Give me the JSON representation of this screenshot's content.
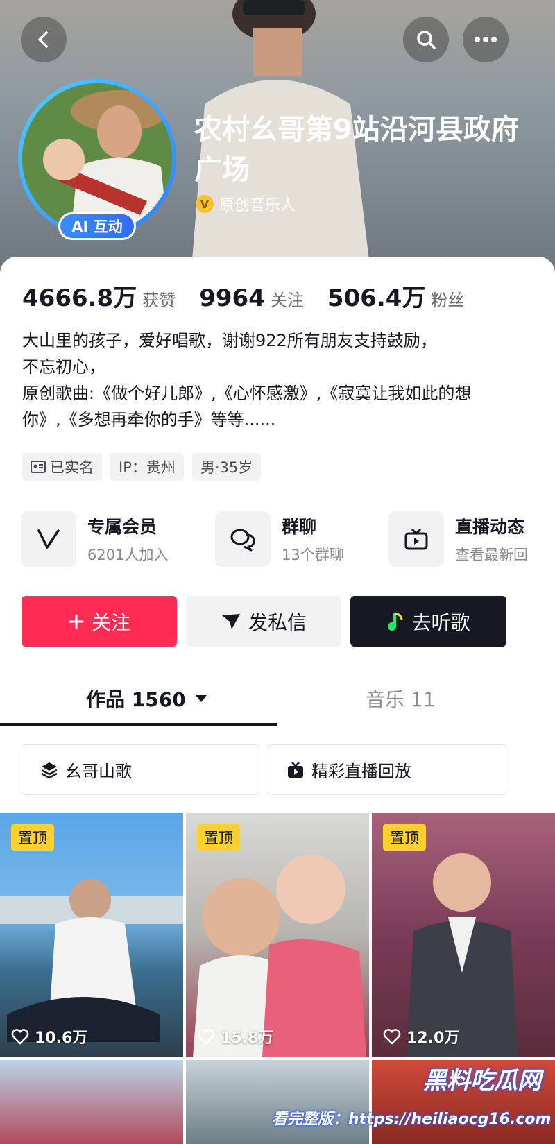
{
  "header": {
    "nickname": "农村幺哥第9站沿河县政府广场",
    "verify_label": "原创音乐人",
    "ai_badge": "AI 互动",
    "verify_mark": "V"
  },
  "stats": [
    {
      "value": "4666.8万",
      "label": "获赞"
    },
    {
      "value": "9964",
      "label": "关注"
    },
    {
      "value": "506.4万",
      "label": "粉丝"
    }
  ],
  "bio": {
    "lines": [
      "大山里的孩子，爱好唱歌，谢谢922所有朋友支持鼓励，",
      "不忘初心，",
      "原创歌曲:《做个好儿郎》,《心怀感激》,《寂寞让我如此的想",
      "你》,《多想再牵你的手》等等......"
    ]
  },
  "tags": [
    "已实名",
    "IP：贵州",
    "男·35岁"
  ],
  "features": [
    {
      "title": "专属会员",
      "sub": "6201人加入"
    },
    {
      "title": "群聊",
      "sub": "13个群聊"
    },
    {
      "title": "直播动态",
      "sub": "查看最新回"
    }
  ],
  "actions": {
    "follow": "关注",
    "message": "发私信",
    "music": "去听歌"
  },
  "tabs": [
    {
      "label": "作品 1560"
    },
    {
      "label": "音乐 11"
    }
  ],
  "collections": [
    "幺哥山歌",
    "精彩直播回放"
  ],
  "videos": [
    {
      "pinned": "置顶",
      "likes": "10.6万"
    },
    {
      "pinned": "置顶",
      "likes": "15.8万"
    },
    {
      "pinned": "置顶",
      "likes": "12.0万"
    }
  ],
  "watermark": {
    "site": "黑料吃瓜网",
    "url": "看完整版：https://heiliaocg16.com"
  },
  "colors": {
    "follow": "#fe2c55",
    "dark": "#161823",
    "gray_bg": "#f2f2f3",
    "pin": "#fed02f",
    "avatar_ring": "#3b8cff"
  }
}
